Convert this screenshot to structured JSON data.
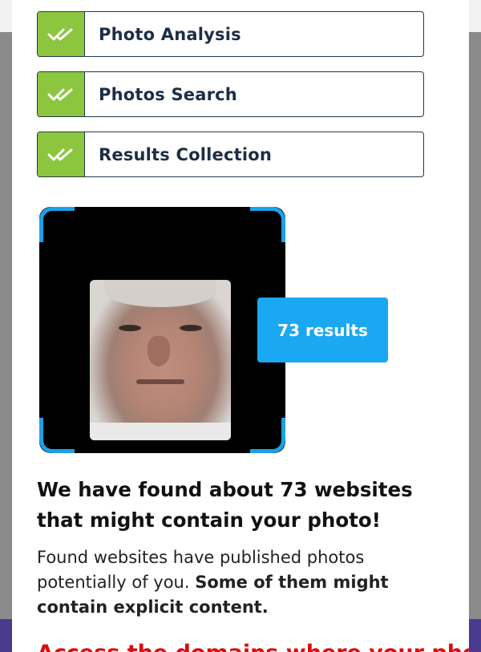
{
  "steps": [
    {
      "label": "Photo Analysis",
      "icon": "double-check-icon"
    },
    {
      "label": "Photos Search",
      "icon": "double-check-icon"
    },
    {
      "label": "Results Collection",
      "icon": "double-check-icon"
    }
  ],
  "results_badge": "73 results",
  "headline": "We have found about 73 websites that might contain your photo!",
  "description": {
    "normal": "Found websites have published photos potentially of you. ",
    "bold": "Some of them might contain explicit content."
  },
  "cta": "Access the domains where your photos",
  "colors": {
    "check_green": "#8cc63f",
    "accent_blue": "#19a8f1",
    "cta_red": "#d80f0f",
    "backdrop_purple": "#4a3a8e"
  }
}
